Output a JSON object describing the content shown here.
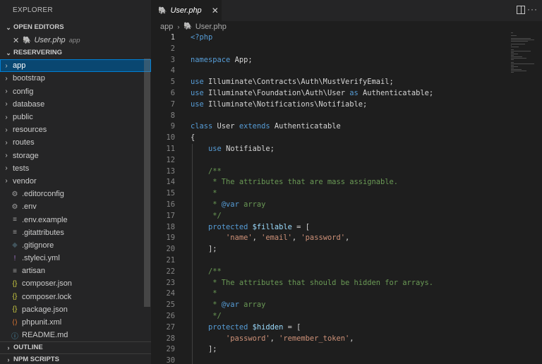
{
  "sidebar": {
    "title": "EXPLORER",
    "open_editors_label": "OPEN EDITORS",
    "open_editor": {
      "name": "User.php",
      "description": "app"
    },
    "project_label": "RESERVERING",
    "folders": [
      "app",
      "bootstrap",
      "config",
      "database",
      "public",
      "resources",
      "routes",
      "storage",
      "tests",
      "vendor"
    ],
    "files": [
      {
        "name": ".editorconfig",
        "icon": "gear-icon",
        "glyph": "⚙",
        "color": "#a0a0a0"
      },
      {
        "name": ".env",
        "icon": "gear-icon",
        "glyph": "⚙",
        "color": "#a0a0a0"
      },
      {
        "name": ".env.example",
        "icon": "lines-icon",
        "glyph": "≡",
        "color": "#a0a0a0"
      },
      {
        "name": ".gitattributes",
        "icon": "lines-icon",
        "glyph": "≡",
        "color": "#a0a0a0"
      },
      {
        "name": ".gitignore",
        "icon": "git-icon",
        "glyph": "◆",
        "color": "#41535b"
      },
      {
        "name": ".styleci.yml",
        "icon": "exclamation-icon",
        "glyph": "!",
        "color": "#a074c4"
      },
      {
        "name": "artisan",
        "icon": "lines-icon",
        "glyph": "≡",
        "color": "#a0a0a0"
      },
      {
        "name": "composer.json",
        "icon": "braces-icon",
        "glyph": "{}",
        "color": "#cbcb41"
      },
      {
        "name": "composer.lock",
        "icon": "braces-icon",
        "glyph": "{}",
        "color": "#cbcb41"
      },
      {
        "name": "package.json",
        "icon": "braces-icon",
        "glyph": "{}",
        "color": "#cbcb41"
      },
      {
        "name": "phpunit.xml",
        "icon": "xml-icon",
        "glyph": "⟨⟩",
        "color": "#e37933"
      },
      {
        "name": "README.md",
        "icon": "info-icon",
        "glyph": "ⓘ",
        "color": "#519aba"
      }
    ],
    "outline_label": "OUTLINE",
    "npm_label": "NPM SCRIPTS"
  },
  "editor": {
    "tab_label": "User.php",
    "breadcrumb": [
      "app",
      "User.php"
    ],
    "active_line": 1,
    "lines": [
      [
        [
          "<?php",
          "kw"
        ]
      ],
      [],
      [
        [
          "namespace",
          "kw"
        ],
        [
          " App;",
          "df"
        ]
      ],
      [],
      [
        [
          "use",
          "kw"
        ],
        [
          " Illuminate\\Contracts\\Auth\\MustVerifyEmail;",
          "df"
        ]
      ],
      [
        [
          "use",
          "kw"
        ],
        [
          " Illuminate\\Foundation\\Auth\\User ",
          "df"
        ],
        [
          "as",
          "kw"
        ],
        [
          " Authenticatable;",
          "df"
        ]
      ],
      [
        [
          "use",
          "kw"
        ],
        [
          " Illuminate\\Notifications\\Notifiable;",
          "df"
        ]
      ],
      [],
      [
        [
          "class",
          "kw"
        ],
        [
          " User ",
          "df"
        ],
        [
          "extends",
          "kw"
        ],
        [
          " Authenticatable",
          "df"
        ]
      ],
      [
        [
          "{",
          "df"
        ]
      ],
      [
        [
          "    ",
          "df"
        ],
        [
          "use",
          "kw"
        ],
        [
          " Notifiable;",
          "df"
        ]
      ],
      [],
      [
        [
          "    /**",
          "cm"
        ]
      ],
      [
        [
          "     * The attributes that are mass assignable.",
          "cm"
        ]
      ],
      [
        [
          "     *",
          "cm"
        ]
      ],
      [
        [
          "     * ",
          "cm"
        ],
        [
          "@var",
          "kw"
        ],
        [
          " array",
          "cm"
        ]
      ],
      [
        [
          "     */",
          "cm"
        ]
      ],
      [
        [
          "    ",
          "df"
        ],
        [
          "protected",
          "kw"
        ],
        [
          " ",
          "df"
        ],
        [
          "$fillable",
          "va"
        ],
        [
          " = [",
          "df"
        ]
      ],
      [
        [
          "        ",
          "df"
        ],
        [
          "'name'",
          "st"
        ],
        [
          ", ",
          "df"
        ],
        [
          "'email'",
          "st"
        ],
        [
          ", ",
          "df"
        ],
        [
          "'password'",
          "st"
        ],
        [
          ",",
          "df"
        ]
      ],
      [
        [
          "    ];",
          "df"
        ]
      ],
      [],
      [
        [
          "    /**",
          "cm"
        ]
      ],
      [
        [
          "     * The attributes that should be hidden for arrays.",
          "cm"
        ]
      ],
      [
        [
          "     *",
          "cm"
        ]
      ],
      [
        [
          "     * ",
          "cm"
        ],
        [
          "@var",
          "kw"
        ],
        [
          " array",
          "cm"
        ]
      ],
      [
        [
          "     */",
          "cm"
        ]
      ],
      [
        [
          "    ",
          "df"
        ],
        [
          "protected",
          "kw"
        ],
        [
          " ",
          "df"
        ],
        [
          "$hidden",
          "va"
        ],
        [
          " = [",
          "df"
        ]
      ],
      [
        [
          "        ",
          "df"
        ],
        [
          "'password'",
          "st"
        ],
        [
          ", ",
          "df"
        ],
        [
          "'remember_token'",
          "st"
        ],
        [
          ",",
          "df"
        ]
      ],
      [
        [
          "    ];",
          "df"
        ]
      ],
      []
    ]
  },
  "colors": {
    "sidebar_bg": "#252526",
    "editor_bg": "#1e1e1e",
    "selection": "#094771",
    "keyword": "#569cd6",
    "comment": "#6a9955",
    "string": "#ce9178",
    "variable": "#9cdcfe"
  }
}
